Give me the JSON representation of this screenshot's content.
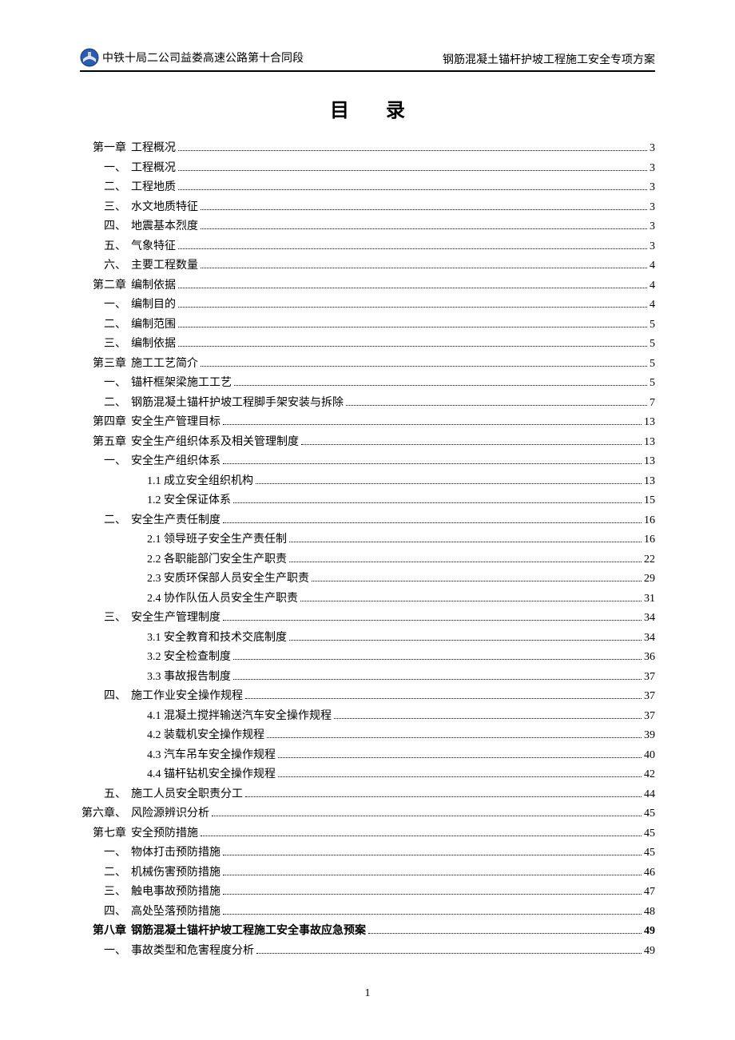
{
  "header": {
    "left": "中铁十局二公司益娄高速公路第十合同段",
    "right": "钢筋混凝土锚杆护坡工程施工安全专项方案"
  },
  "title": "目 录",
  "page_number": "1",
  "toc": [
    {
      "level": "chapter",
      "label": "第一章",
      "text": "工程概况",
      "page": "3"
    },
    {
      "level": "section",
      "label": "一、",
      "text": "工程概况",
      "page": "3"
    },
    {
      "level": "section",
      "label": "二、",
      "text": "工程地质",
      "page": "3"
    },
    {
      "level": "section",
      "label": "三、",
      "text": "水文地质特征",
      "page": "3"
    },
    {
      "level": "section",
      "label": "四、",
      "text": "地震基本烈度",
      "page": "3"
    },
    {
      "level": "section",
      "label": "五、",
      "text": "气象特征",
      "page": "3"
    },
    {
      "level": "section",
      "label": "六、",
      "text": "主要工程数量",
      "page": "4"
    },
    {
      "level": "chapter",
      "label": "第二章",
      "text": "编制依据",
      "page": "4"
    },
    {
      "level": "section",
      "label": "一、",
      "text": "编制目的",
      "page": "4"
    },
    {
      "level": "section",
      "label": "二、",
      "text": "编制范围",
      "page": "5"
    },
    {
      "level": "section",
      "label": "三、",
      "text": "编制依据",
      "page": "5"
    },
    {
      "level": "chapter",
      "label": "第三章",
      "text": "施工工艺简介",
      "page": "5"
    },
    {
      "level": "section",
      "label": "一、",
      "text": "锚杆框架梁施工工艺",
      "page": "5"
    },
    {
      "level": "section",
      "label": "二、",
      "text": "钢筋混凝土锚杆护坡工程脚手架安装与拆除",
      "page": "7"
    },
    {
      "level": "chapter",
      "label": "第四章",
      "text": "安全生产管理目标",
      "page": "13"
    },
    {
      "level": "chapter",
      "label": "第五章",
      "text": "安全生产组织体系及相关管理制度",
      "page": "13"
    },
    {
      "level": "section",
      "label": "一、",
      "text": "安全生产组织体系",
      "page": "13"
    },
    {
      "level": "sub",
      "label": "",
      "text": "1.1 成立安全组织机构",
      "page": "13"
    },
    {
      "level": "sub",
      "label": "",
      "text": "1.2 安全保证体系",
      "page": "15"
    },
    {
      "level": "section",
      "label": "二、",
      "text": "安全生产责任制度",
      "page": "16"
    },
    {
      "level": "sub",
      "label": "",
      "text": "2.1 领导班子安全生产责任制",
      "page": "16"
    },
    {
      "level": "sub",
      "label": "",
      "text": "2.2 各职能部门安全生产职责",
      "page": "22"
    },
    {
      "level": "sub",
      "label": "",
      "text": "2.3 安质环保部人员安全生产职责",
      "page": "29"
    },
    {
      "level": "sub",
      "label": "",
      "text": "2.4 协作队伍人员安全生产职责",
      "page": "31"
    },
    {
      "level": "section",
      "label": "三、",
      "text": "安全生产管理制度",
      "page": "34"
    },
    {
      "level": "sub",
      "label": "",
      "text": "3.1 安全教育和技术交底制度",
      "page": "34"
    },
    {
      "level": "sub",
      "label": "",
      "text": "3.2 安全检查制度",
      "page": "36"
    },
    {
      "level": "sub",
      "label": "",
      "text": "3.3 事故报告制度",
      "page": "37"
    },
    {
      "level": "section",
      "label": "四、",
      "text": "施工作业安全操作规程",
      "page": "37"
    },
    {
      "level": "sub",
      "label": "",
      "text": "4.1 混凝土搅拌输送汽车安全操作规程",
      "page": "37"
    },
    {
      "level": "sub",
      "label": "",
      "text": "4.2 装载机安全操作规程",
      "page": "39"
    },
    {
      "level": "sub",
      "label": "",
      "text": "4.3 汽车吊车安全操作规程",
      "page": "40"
    },
    {
      "level": "sub",
      "label": "",
      "text": "4.4 锚杆钻机安全操作规程",
      "page": "42"
    },
    {
      "level": "section",
      "label": "五、",
      "text": "施工人员安全职责分工",
      "page": "44"
    },
    {
      "level": "chapter",
      "label": "第六章、",
      "text": "风险源辨识分析",
      "page": "45"
    },
    {
      "level": "chapter",
      "label": "第七章",
      "text": "安全预防措施",
      "page": "45"
    },
    {
      "level": "section",
      "label": "一、",
      "text": "物体打击预防措施",
      "page": "45"
    },
    {
      "level": "section",
      "label": "二、",
      "text": "机械伤害预防措施",
      "page": "46"
    },
    {
      "level": "section",
      "label": "三、",
      "text": "触电事故预防措施",
      "page": "47"
    },
    {
      "level": "section",
      "label": "四、",
      "text": "高处坠落预防措施",
      "page": "48"
    },
    {
      "level": "chapter",
      "label": "第八章",
      "text": "钢筋混凝土锚杆护坡工程施工安全事故应急预案",
      "page": "49",
      "bold": true
    },
    {
      "level": "section",
      "label": "一、",
      "text": "事故类型和危害程度分析",
      "page": "49"
    }
  ]
}
